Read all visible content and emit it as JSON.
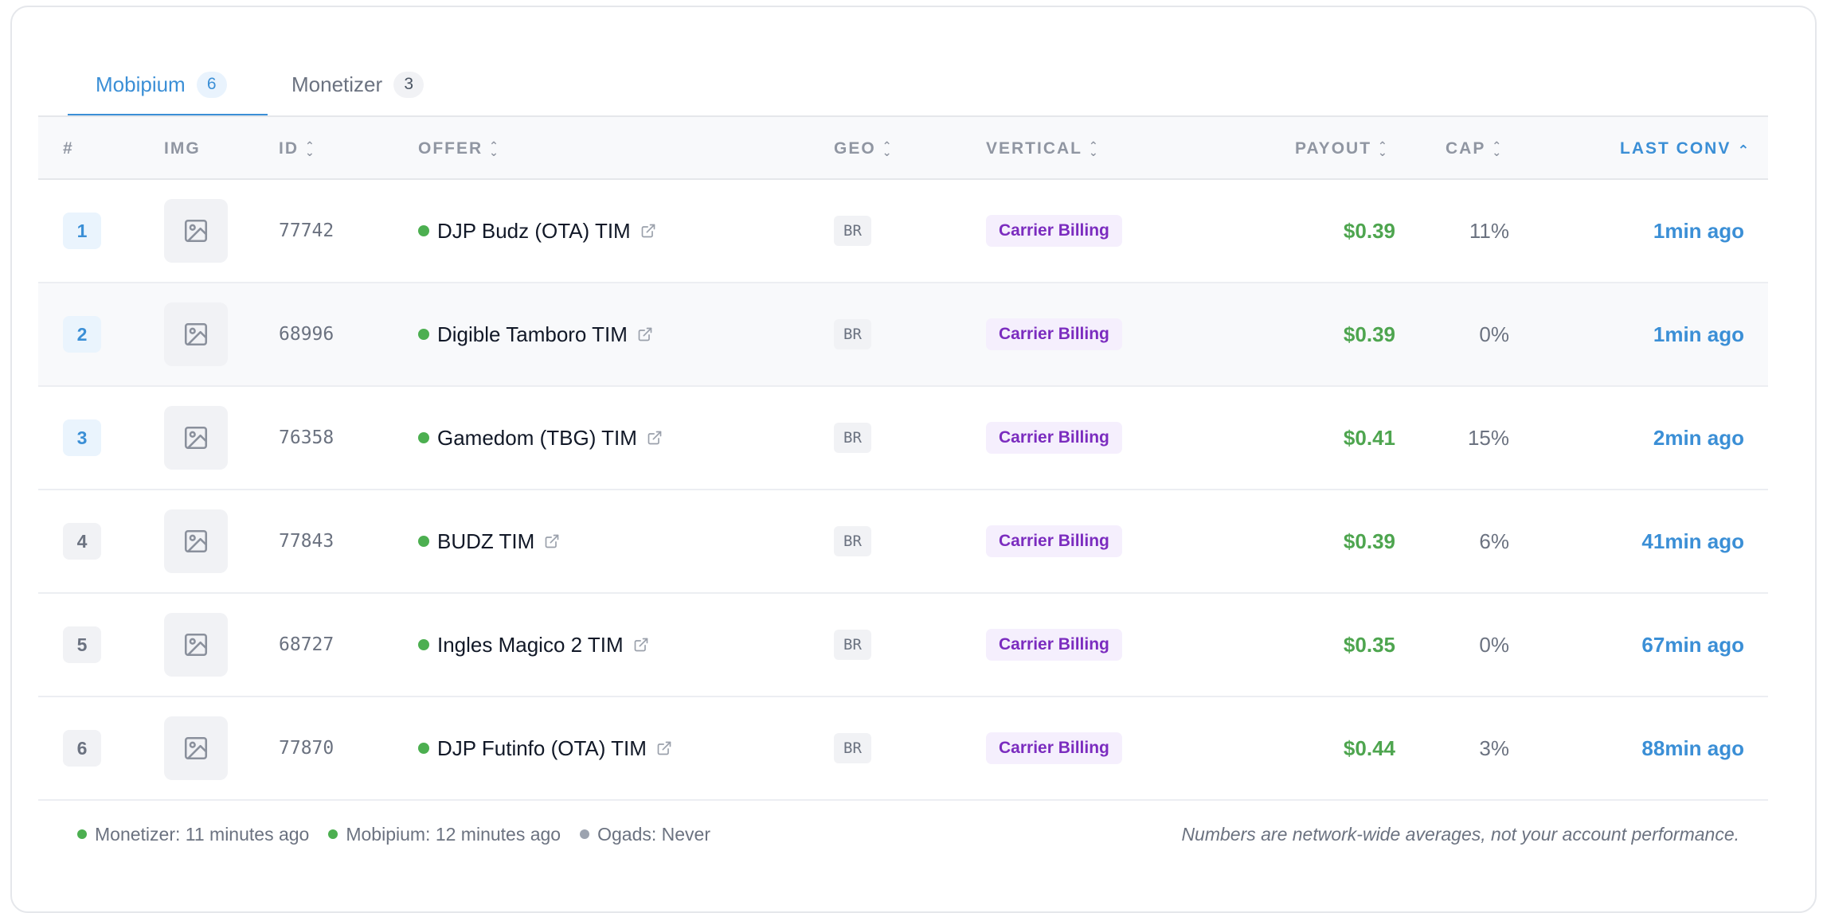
{
  "tabs": [
    {
      "label": "Mobipium",
      "count": "6",
      "active": true
    },
    {
      "label": "Monetizer",
      "count": "3",
      "active": false
    }
  ],
  "columns": {
    "rank": "#",
    "img": "IMG",
    "id": "ID",
    "offer": "OFFER",
    "geo": "GEO",
    "vertical": "VERTICAL",
    "payout": "PAYOUT",
    "cap": "CAP",
    "last_conv": "LAST CONV"
  },
  "sort": {
    "column": "last_conv",
    "direction": "ascending"
  },
  "rows": [
    {
      "rank": "1",
      "id": "77742",
      "offer": "DJP Budz (OTA) TIM",
      "geo": "BR",
      "vertical": "Carrier Billing",
      "payout": "$0.39",
      "cap": "11%",
      "last_conv": "1min ago"
    },
    {
      "rank": "2",
      "id": "68996",
      "offer": "Digible Tamboro TIM",
      "geo": "BR",
      "vertical": "Carrier Billing",
      "payout": "$0.39",
      "cap": "0%",
      "last_conv": "1min ago"
    },
    {
      "rank": "3",
      "id": "76358",
      "offer": "Gamedom (TBG) TIM",
      "geo": "BR",
      "vertical": "Carrier Billing",
      "payout": "$0.41",
      "cap": "15%",
      "last_conv": "2min ago"
    },
    {
      "rank": "4",
      "id": "77843",
      "offer": "BUDZ TIM",
      "geo": "BR",
      "vertical": "Carrier Billing",
      "payout": "$0.39",
      "cap": "6%",
      "last_conv": "41min ago"
    },
    {
      "rank": "5",
      "id": "68727",
      "offer": "Ingles Magico 2 TIM",
      "geo": "BR",
      "vertical": "Carrier Billing",
      "payout": "$0.35",
      "cap": "0%",
      "last_conv": "67min ago"
    },
    {
      "rank": "6",
      "id": "77870",
      "offer": "DJP Futinfo (OTA) TIM",
      "geo": "BR",
      "vertical": "Carrier Billing",
      "payout": "$0.44",
      "cap": "3%",
      "last_conv": "88min ago"
    }
  ],
  "footer": {
    "sources": [
      {
        "text": "Monetizer: 11 minutes ago",
        "color": "#4caf50"
      },
      {
        "text": "Mobipium: 12 minutes ago",
        "color": "#4caf50"
      },
      {
        "text": "Ogads: Never",
        "color": "#9ca3af"
      }
    ],
    "note": "Numbers are network-wide averages, not your account performance."
  },
  "colors": {
    "accent": "#3b8fd6",
    "payout": "#4ea54f",
    "vertical_text": "#7b2cbf",
    "active_dot": "#4caf50"
  },
  "icons": {
    "thumbnail": "image-placeholder-icon",
    "offer_link": "external-link-icon",
    "sort": "sort-chevrons-icon"
  }
}
